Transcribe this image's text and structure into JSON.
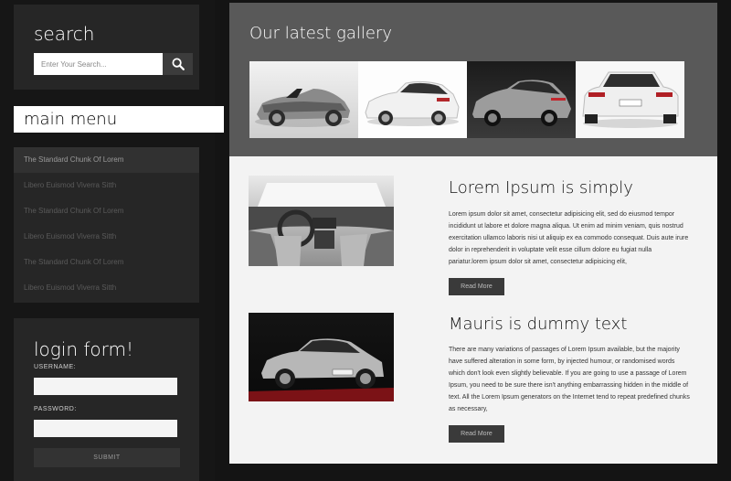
{
  "search": {
    "title": "search",
    "placeholder": "Enter Your Search..."
  },
  "menu": {
    "title": "main menu",
    "items": [
      "The Standard Chunk Of Lorem",
      "Libero Euismod Viverra Sitth",
      "The Standard Chunk Of Lorem",
      "Libero Euismod Viverra Sitth",
      "The Standard Chunk Of Lorem",
      "Libero Euismod Viverra Sitth"
    ]
  },
  "login": {
    "title": "login form!",
    "username_label": "USERNAME:",
    "password_label": "PASSWORD:",
    "submit_label": "SUBMIT"
  },
  "gallery": {
    "title": "Our latest gallery"
  },
  "articles": [
    {
      "title": "Lorem Ipsum is simply",
      "body": "Lorem ipsum dolor sit amet, consectetur adipisicing elit, sed do eiusmod tempor incididunt ut labore et dolore magna aliqua. Ut enim ad minim veniam, quis nostrud exercitation ullamco laboris nisi ut aliquip ex ea commodo consequat. Duis aute irure dolor in reprehenderit in voluptate velit esse cillum dolore eu fugiat nulla pariatur.lorem ipsum dolor sit amet, consectetur adipisicing elit,",
      "button": "Read More"
    },
    {
      "title": "Mauris is dummy text",
      "body": "There are many variations of passages of Lorem Ipsum available, but the majority have suffered alteration in some form, by injected humour, or randomised words which don't look even slightly believable. If you are going to use a passage of Lorem Ipsum, you need to be sure there isn't anything embarrassing hidden in the middle of text. All the Lorem Ipsum generators on the Internet tend to repeat predefined chunks as necessary,",
      "button": "Read More"
    }
  ],
  "colors": {
    "background": "#141414",
    "panel": "#262626",
    "gallery": "#595959",
    "content": "#f3f3f3",
    "button": "#3a3a3a"
  }
}
